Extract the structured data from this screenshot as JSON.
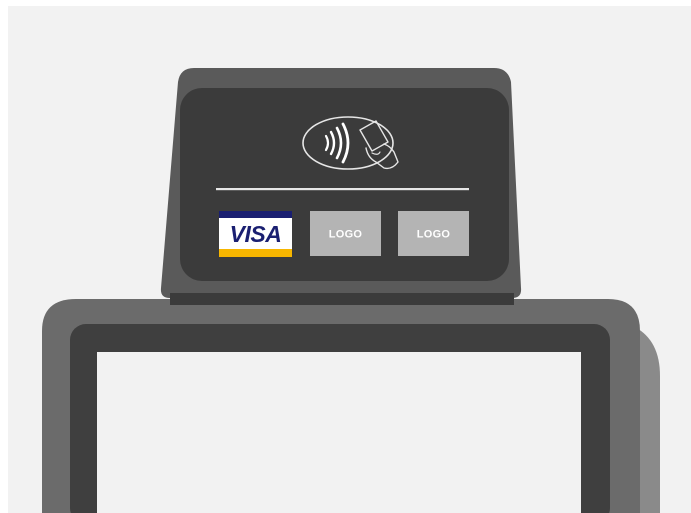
{
  "acceptance_marks": {
    "visa_label": "VISA",
    "logo_2_label": "LOGO",
    "logo_3_label": "LOGO"
  },
  "icons": {
    "contactless": "contactless-tap-icon"
  },
  "colors": {
    "background": "#f2f2f2",
    "housing_dark": "#4a4a4a",
    "housing_panel": "#3f3f3f",
    "housing_light": "#6b6b6b",
    "screen": "#f2f2f2",
    "divider": "#e6e6e6",
    "logo_placeholder": "#b4b4b4",
    "visa_blue": "#1a1f71",
    "visa_gold": "#f7b600"
  }
}
